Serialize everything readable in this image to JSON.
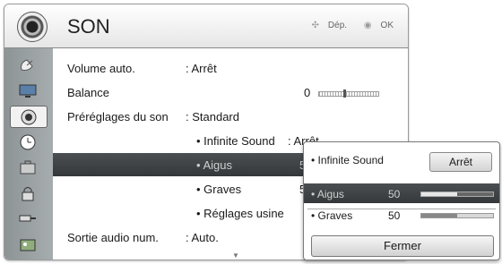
{
  "header": {
    "title": "SON",
    "icon": "speaker-icon",
    "hints": [
      {
        "symbol": "✣",
        "label": "Dép."
      },
      {
        "symbol": "◉",
        "label": "OK"
      }
    ]
  },
  "sidebar": {
    "items": [
      {
        "icon": "satellite-dish-icon"
      },
      {
        "icon": "tv-screen-icon"
      },
      {
        "icon": "speaker-icon",
        "active": true
      },
      {
        "icon": "clock-icon"
      },
      {
        "icon": "briefcase-icon"
      },
      {
        "icon": "lock-icon"
      },
      {
        "icon": "input-plug-icon"
      },
      {
        "icon": "media-icon"
      }
    ]
  },
  "menu": {
    "volume_auto": {
      "label": "Volume auto.",
      "value": ": Arrêt"
    },
    "balance": {
      "label": "Balance",
      "value": "0",
      "level": 0.5
    },
    "preset": {
      "label": "Préréglages du son",
      "value": ": Standard"
    },
    "infinite_sound": {
      "label": "• Infinite Sound",
      "value": ": Arrêt"
    },
    "treble": {
      "label": "• Aigus",
      "value": "5"
    },
    "bass": {
      "label": "• Graves",
      "value": "5"
    },
    "factory_reset": {
      "label": "• Réglages usine"
    },
    "digital_out": {
      "label": "Sortie audio num.",
      "value": ": Auto."
    }
  },
  "popup": {
    "infinite_sound": {
      "label": "• Infinite Sound",
      "button": "Arrêt"
    },
    "treble": {
      "label": "• Aigus",
      "value": "50",
      "level": 0.5
    },
    "bass": {
      "label": "• Graves",
      "value": "50",
      "level": 0.5
    },
    "close": "Fermer"
  }
}
